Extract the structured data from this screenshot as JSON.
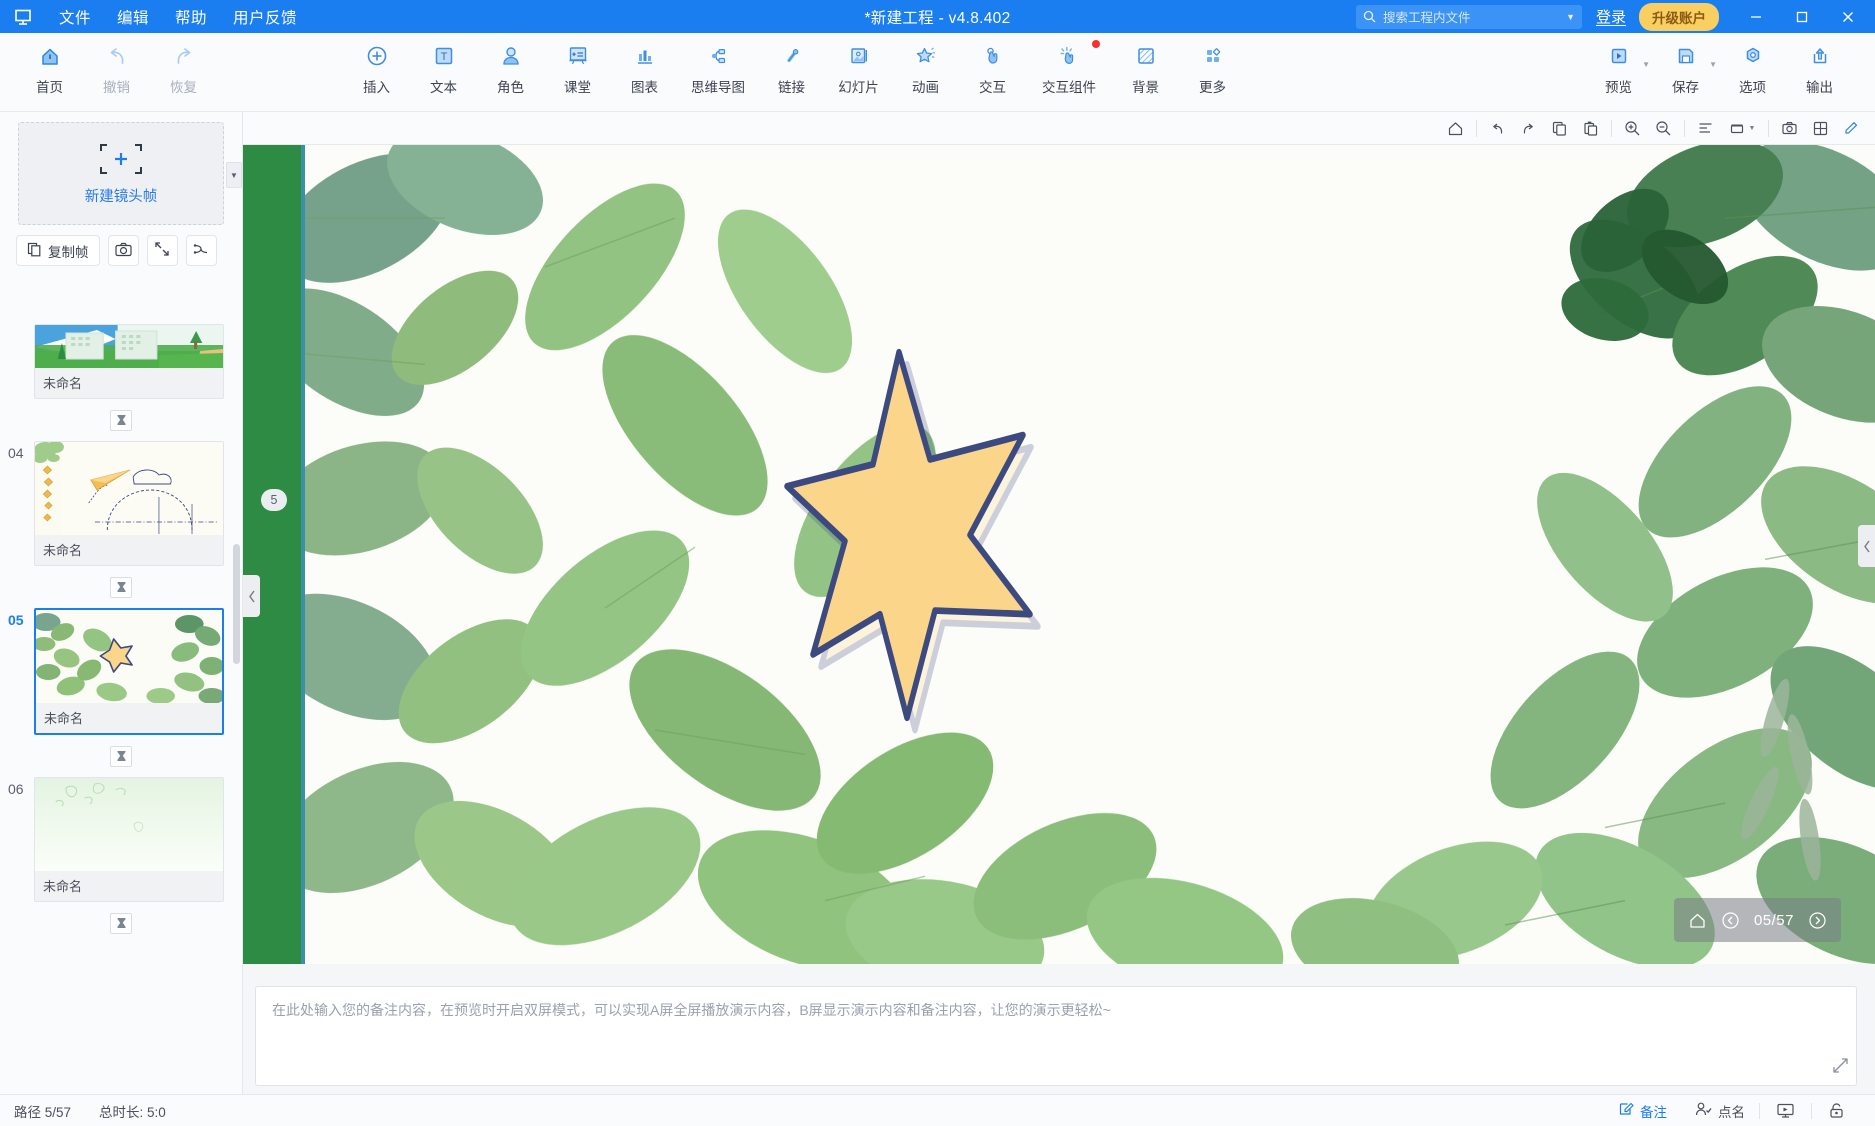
{
  "titlebar": {
    "logo_icon": "app-logo-icon",
    "menus": [
      "文件",
      "编辑",
      "帮助",
      "用户反馈"
    ],
    "title": "*新建工程 - v4.8.402",
    "search": {
      "placeholder": "搜索工程内文件",
      "icon": "search-icon",
      "dropdown_icon": "chevron-down-icon"
    },
    "login_label": "登录",
    "upgrade_label": "升级账户",
    "minimize_icon": "minimize-icon",
    "maximize_icon": "maximize-icon",
    "close_icon": "close-icon"
  },
  "ribbon": {
    "left_group": [
      {
        "label": "首页",
        "icon": "home-icon",
        "dim": false
      },
      {
        "label": "撤销",
        "icon": "undo-icon",
        "dim": true
      },
      {
        "label": "恢复",
        "icon": "redo-icon",
        "dim": true
      }
    ],
    "main_group": [
      {
        "label": "插入",
        "icon": "plus-circle-icon"
      },
      {
        "label": "文本",
        "icon": "text-box-icon"
      },
      {
        "label": "角色",
        "icon": "character-icon"
      },
      {
        "label": "课堂",
        "icon": "classroom-icon"
      },
      {
        "label": "图表",
        "icon": "chart-bar-icon"
      },
      {
        "label": "思维导图",
        "icon": "mindmap-icon"
      },
      {
        "label": "链接",
        "icon": "link-icon"
      },
      {
        "label": "幻灯片",
        "icon": "slide-image-icon"
      },
      {
        "label": "动画",
        "icon": "star-animation-icon"
      },
      {
        "label": "交互",
        "icon": "hand-tap-icon"
      },
      {
        "label": "交互组件",
        "icon": "interactive-component-icon",
        "badge": true
      },
      {
        "label": "背景",
        "icon": "background-icon"
      },
      {
        "label": "更多",
        "icon": "grid-more-icon"
      }
    ],
    "right_group": [
      {
        "label": "预览",
        "icon": "play-preview-icon",
        "caret": true
      },
      {
        "label": "保存",
        "icon": "save-disk-icon",
        "caret": true
      },
      {
        "label": "选项",
        "icon": "options-gear-icon"
      },
      {
        "label": "输出",
        "icon": "export-upload-icon"
      }
    ]
  },
  "left_panel": {
    "new_frame_label": "新建镜头帧",
    "new_frame_icon": "add-frame-icon",
    "new_frame_dropdown_icon": "chevron-down-icon",
    "tools": [
      {
        "label": "复制帧",
        "icon": "copy-frame-icon",
        "type": "wide"
      },
      {
        "label": "",
        "icon": "camera-icon",
        "type": "square"
      },
      {
        "label": "",
        "icon": "fit-frame-icon",
        "type": "square"
      },
      {
        "label": "",
        "icon": "reorder-icon",
        "type": "square"
      }
    ],
    "transition_icon": "hourglass-icon",
    "slides": [
      {
        "num": "",
        "name": "未命名",
        "active": false,
        "thumb": "city-landscape"
      },
      {
        "num": "04",
        "name": "未命名",
        "active": false,
        "thumb": "paper-plane-sketch"
      },
      {
        "num": "05",
        "name": "未命名",
        "active": true,
        "thumb": "leaves-star"
      },
      {
        "num": "06",
        "name": "未命名",
        "active": false,
        "thumb": "light-green-blank"
      }
    ]
  },
  "canvas_toolbar": {
    "buttons": [
      {
        "icon": "home-outline-icon"
      },
      {
        "icon": "undo-arrow-icon"
      },
      {
        "icon": "redo-arrow-icon"
      },
      {
        "icon": "copy-icon"
      },
      {
        "icon": "paste-icon"
      },
      {
        "icon": "zoom-in-icon"
      },
      {
        "icon": "zoom-out-icon"
      },
      {
        "icon": "align-icon"
      },
      {
        "icon": "layer-icon",
        "caret": true
      },
      {
        "icon": "camera-shot-icon"
      },
      {
        "icon": "grid-layout-icon"
      },
      {
        "icon": "edit-pencil-icon"
      }
    ]
  },
  "canvas": {
    "frame_badge": "5",
    "collapse_left_icon": "chevron-left-icon",
    "collapse_right_icon": "chevron-left-icon",
    "pager": {
      "home_icon": "home-small-icon",
      "prev_icon": "prev-circle-icon",
      "text": "05/57",
      "next_icon": "next-circle-icon"
    }
  },
  "notes": {
    "placeholder": "在此处输入您的备注内容，在预览时开启双屏模式，可以实现A屏全屏播放演示内容，B屏显示演示内容和备注内容，让您的演示更轻松~",
    "expand_icon": "expand-icon"
  },
  "statusbar": {
    "path_label": "路径 5/57",
    "duration_label": "总时长: 5:0",
    "items": [
      {
        "label": "备注",
        "icon": "note-edit-icon",
        "accent": true
      },
      {
        "label": "点名",
        "icon": "roll-call-icon",
        "accent": false
      }
    ],
    "icon_buttons": [
      {
        "icon": "presenter-screen-icon"
      },
      {
        "icon": "lock-icon"
      }
    ]
  },
  "colors": {
    "brand_blue": "#1a7ef0",
    "upgrade_yellow": "#f8cf60",
    "badge_red": "#f5312d",
    "star_fill": "#fbd68a",
    "star_stroke": "#3c4a80",
    "green_bar": "#2e8b44"
  }
}
